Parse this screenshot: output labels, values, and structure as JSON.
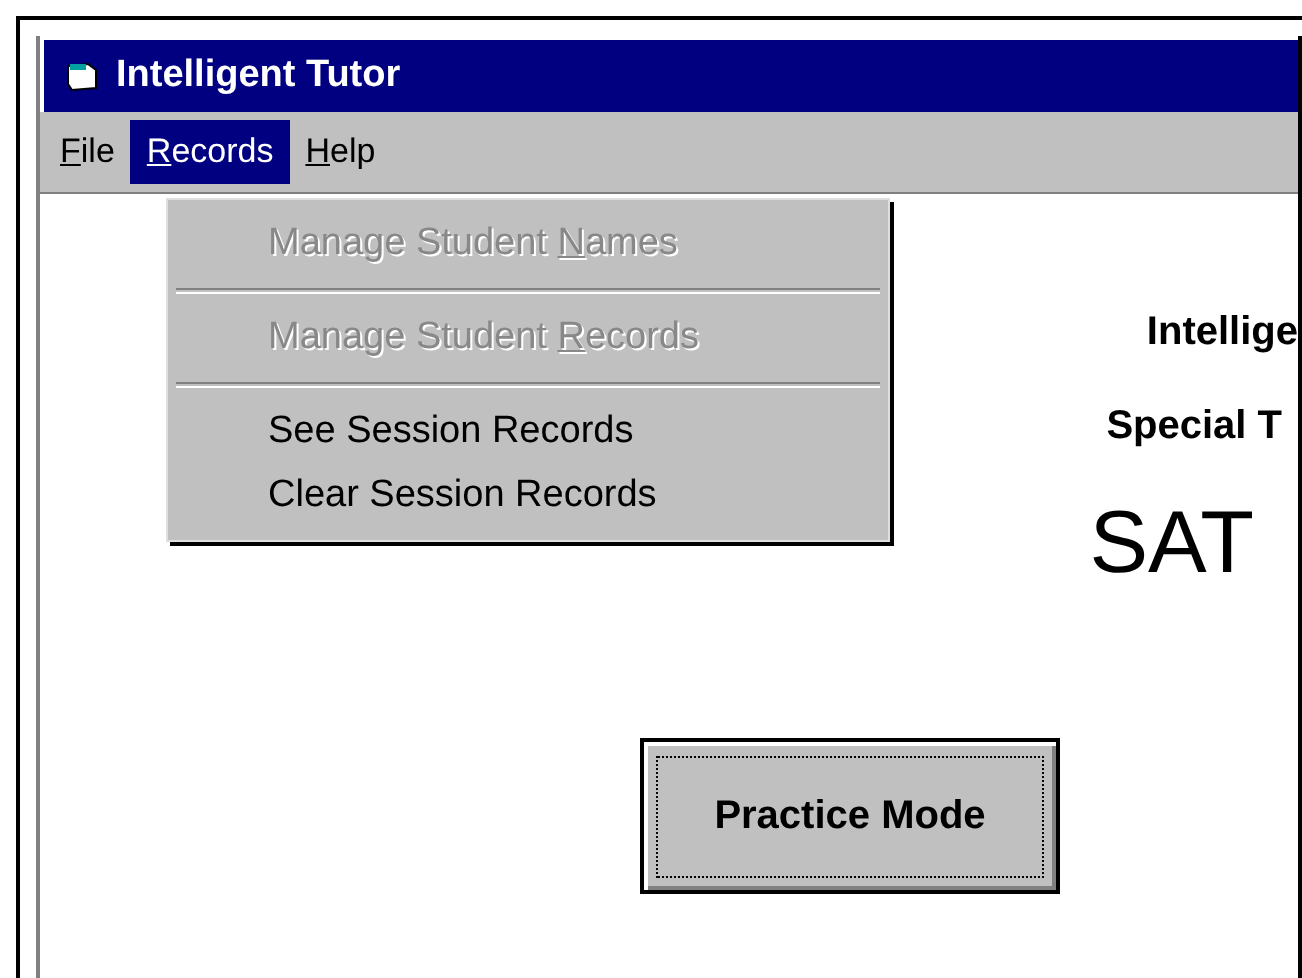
{
  "window": {
    "title": "Intelligent Tutor"
  },
  "menu_bar": [
    {
      "parts": {
        "key": "F",
        "after": "ile"
      },
      "selected": false
    },
    {
      "parts": {
        "key": "R",
        "after": "ecords"
      },
      "selected": true
    },
    {
      "parts": {
        "key": "H",
        "after": "elp"
      },
      "selected": false
    }
  ],
  "dropdown": {
    "groups": [
      [
        {
          "parts": {
            "before": "Manage Student ",
            "key": "N",
            "after": "ames"
          },
          "disabled": true
        }
      ],
      [
        {
          "parts": {
            "before": "Manage Student ",
            "key": "R",
            "after": "ecords"
          },
          "disabled": true
        }
      ],
      [
        {
          "parts": {
            "before": "See Session Records"
          },
          "disabled": false
        },
        {
          "parts": {
            "before": "Clear Session Records"
          },
          "disabled": false
        }
      ]
    ]
  },
  "content": {
    "heading": "Intellige",
    "subheading": "Special T",
    "title": "SAT",
    "button": "Practice Mode"
  }
}
